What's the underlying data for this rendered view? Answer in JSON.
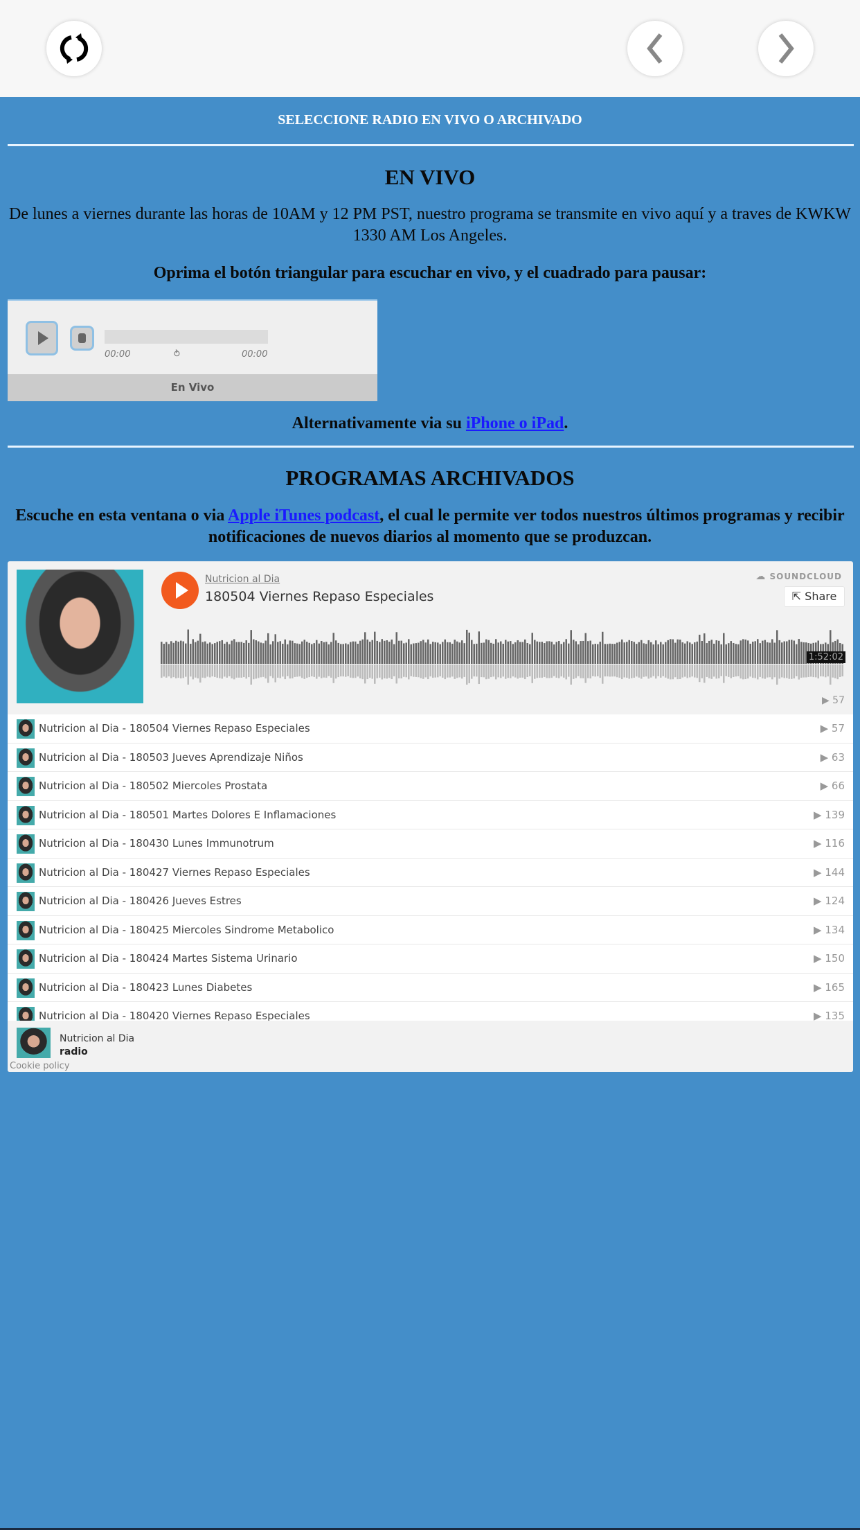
{
  "colors": {
    "background": "#448ec9",
    "accent_orange": "#f25a1e",
    "link": "#1a1aff"
  },
  "topbar": {
    "refresh_icon": "refresh-icon",
    "back_icon": "chevron-left-icon",
    "forward_icon": "chevron-right-icon"
  },
  "header": {
    "select_label": "SELECCIONE RADIO EN VIVO O ARCHIVADO"
  },
  "live": {
    "title": "EN VIVO",
    "description": "De lunes a viernes durante las horas de 10AM y 12 PM PST, nuestro programa se transmite en vivo aquí y a traves de KWKW 1330 AM Los Angeles.",
    "instructions": "Oprima el botón triangular para escuchar en vivo, y el cuadrado para pausar:",
    "player": {
      "current_time": "00:00",
      "total_time": "00:00",
      "label": "En Vivo",
      "progress": 0
    },
    "alt_prefix": "Alternativamente via su ",
    "alt_link": "iPhone o iPad",
    "alt_suffix": "."
  },
  "archive": {
    "title": "PROGRAMAS ARCHIVADOS",
    "intro_prefix": "Escuche en esta ventana o via ",
    "intro_link": "Apple iTunes podcast",
    "intro_suffix": ", el cual le permite ver todos nuestros últimos programas y recibir notificaciones de nuevos diarios al momento que se produzcan."
  },
  "soundcloud": {
    "brand": "SOUNDCLOUD",
    "share_label": "Share",
    "user": "Nutricion al Dia",
    "track_title": "180504 Viernes Repaso Especiales",
    "duration": "1:52:02",
    "play_count": "57",
    "tracks": [
      {
        "title": "Nutricion al Dia - 180504 Viernes Repaso Especiales",
        "plays": "57"
      },
      {
        "title": "Nutricion al Dia - 180503 Jueves Aprendizaje Niños",
        "plays": "63"
      },
      {
        "title": "Nutricion al Dia - 180502 Miercoles Prostata",
        "plays": "66"
      },
      {
        "title": "Nutricion al Dia - 180501 Martes Dolores E Inflamaciones",
        "plays": "139"
      },
      {
        "title": "Nutricion al Dia - 180430 Lunes Immunotrum",
        "plays": "116"
      },
      {
        "title": "Nutricion al Dia - 180427 Viernes Repaso Especiales",
        "plays": "144"
      },
      {
        "title": "Nutricion al Dia - 180426 Jueves Estres",
        "plays": "124"
      },
      {
        "title": "Nutricion al Dia - 180425 Miercoles Sindrome Metabolico",
        "plays": "134"
      },
      {
        "title": "Nutricion al Dia - 180424 Martes Sistema Urinario",
        "plays": "150"
      },
      {
        "title": "Nutricion al Dia - 180423 Lunes Diabetes",
        "plays": "165"
      },
      {
        "title": "Nutricion al Dia - 180420 Viernes Repaso Especiales",
        "plays": "135"
      }
    ],
    "footer": {
      "name": "Nutricion al Dia",
      "playlist": "radio",
      "cookie": "Cookie policy"
    }
  }
}
